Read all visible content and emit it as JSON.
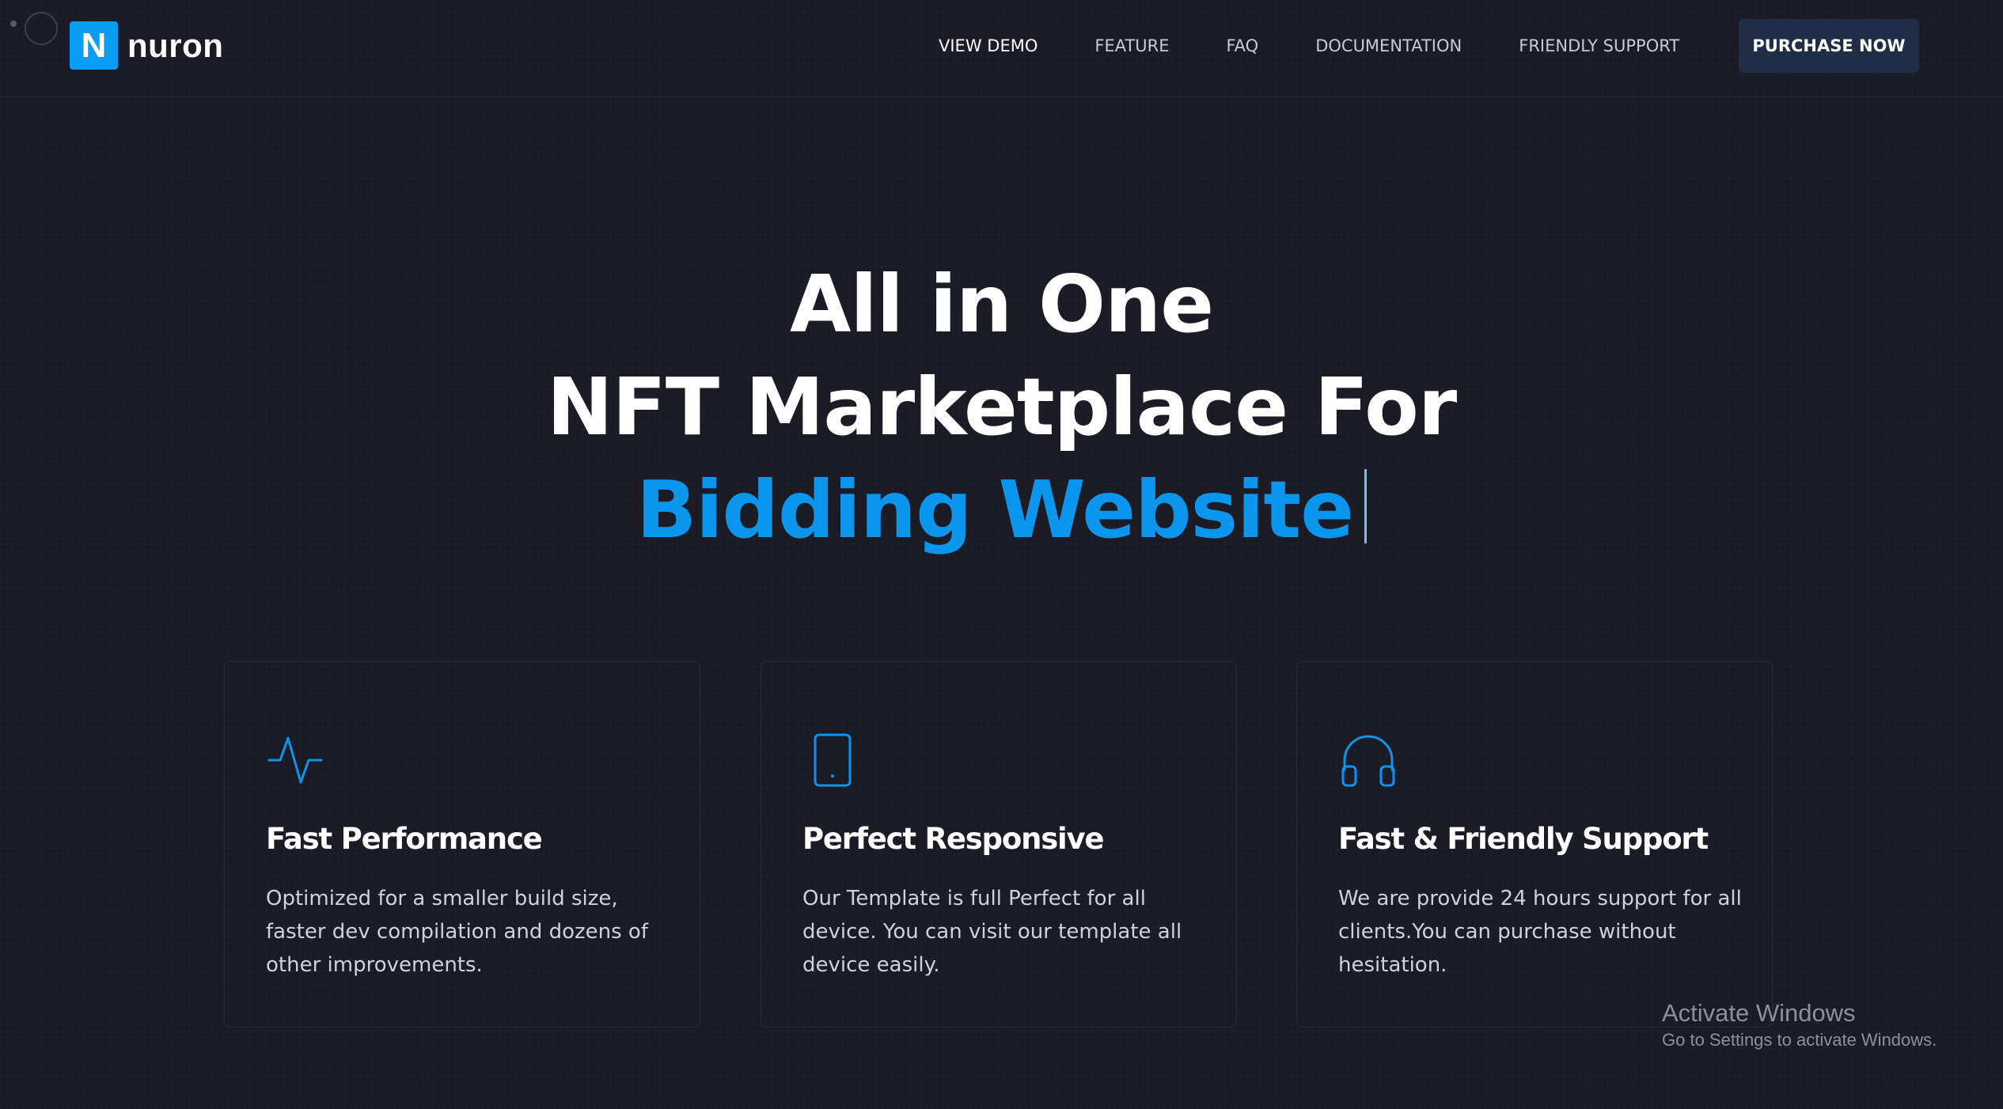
{
  "brand": {
    "logo_letter": "N",
    "name": "nuron",
    "accent_color": "#0a9cf2"
  },
  "nav": {
    "items": [
      {
        "label": "VIEW DEMO",
        "active": true
      },
      {
        "label": "FEATURE",
        "active": false
      },
      {
        "label": "FAQ",
        "active": false
      },
      {
        "label": "DOCUMENTATION",
        "active": false
      },
      {
        "label": "FRIENDLY SUPPORT",
        "active": false
      }
    ],
    "cta_label": "PURCHASE NOW"
  },
  "hero": {
    "line1": "All in One",
    "line2": "NFT Marketplace For",
    "line3": "Bidding Website",
    "accent_color": "#0b96ee"
  },
  "features": [
    {
      "icon": "activity-icon",
      "title": "Fast Performance",
      "text": "Optimized for a smaller build size, faster dev compilation and dozens of other improvements."
    },
    {
      "icon": "tablet-icon",
      "title": "Perfect Responsive",
      "text": "Our Template is full Perfect for all device. You can visit our template all device easily."
    },
    {
      "icon": "headphones-icon",
      "title": "Fast & Friendly Support",
      "text": "We are provide 24 hours support for all clients.You can purchase without hesitation."
    }
  ],
  "watermark": {
    "title": "Activate Windows",
    "subtitle": "Go to Settings to activate Windows."
  }
}
